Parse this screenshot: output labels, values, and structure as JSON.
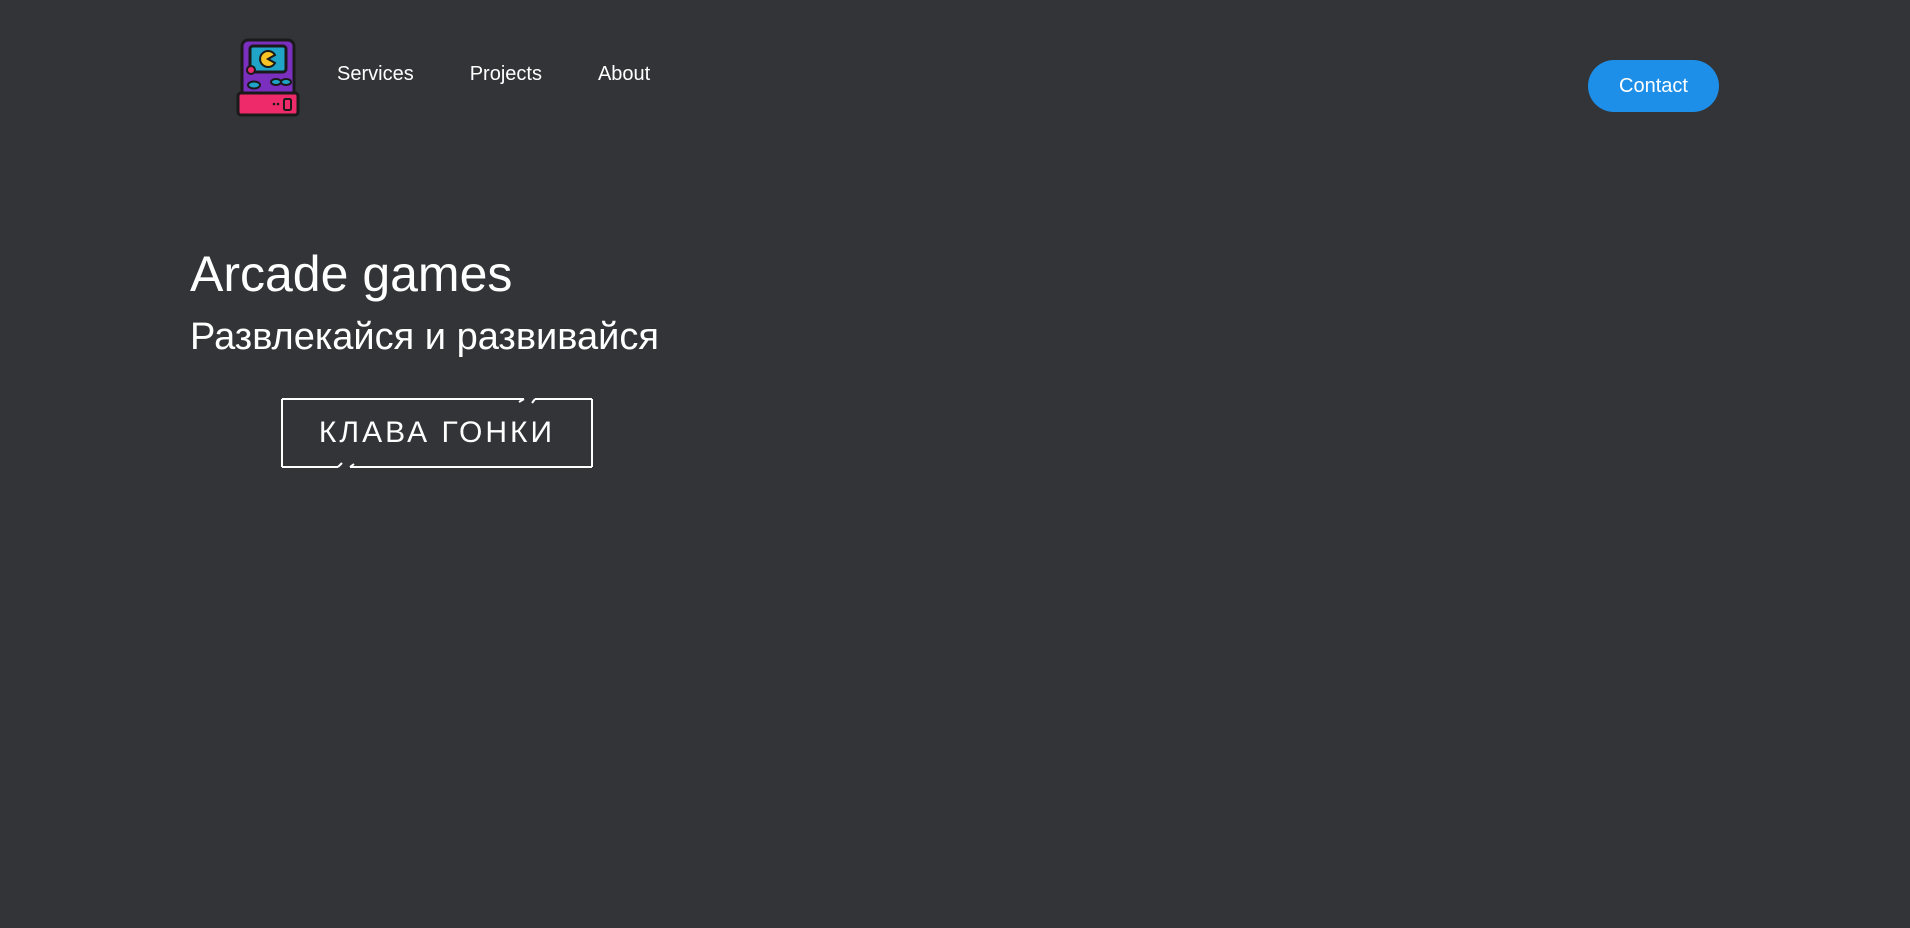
{
  "header": {
    "logo": {
      "icon": "arcade-cabinet-icon",
      "colors": {
        "cabinet": "#7b2fbe",
        "base": "#ee2a6b",
        "screen": "#20a4c8",
        "pacman": "#f7c325",
        "outline": "#1a1a1a"
      }
    },
    "nav": [
      {
        "label": "Services"
      },
      {
        "label": "Projects"
      },
      {
        "label": "About"
      }
    ],
    "contact_label": "Contact",
    "contact_color": "#1e8fe8"
  },
  "hero": {
    "title": "Arcade games",
    "subtitle": "Развлекайся и развивайся",
    "cta_label": "КЛАВА ГОНКИ"
  },
  "theme": {
    "background": "#333438",
    "text": "#ffffff"
  }
}
